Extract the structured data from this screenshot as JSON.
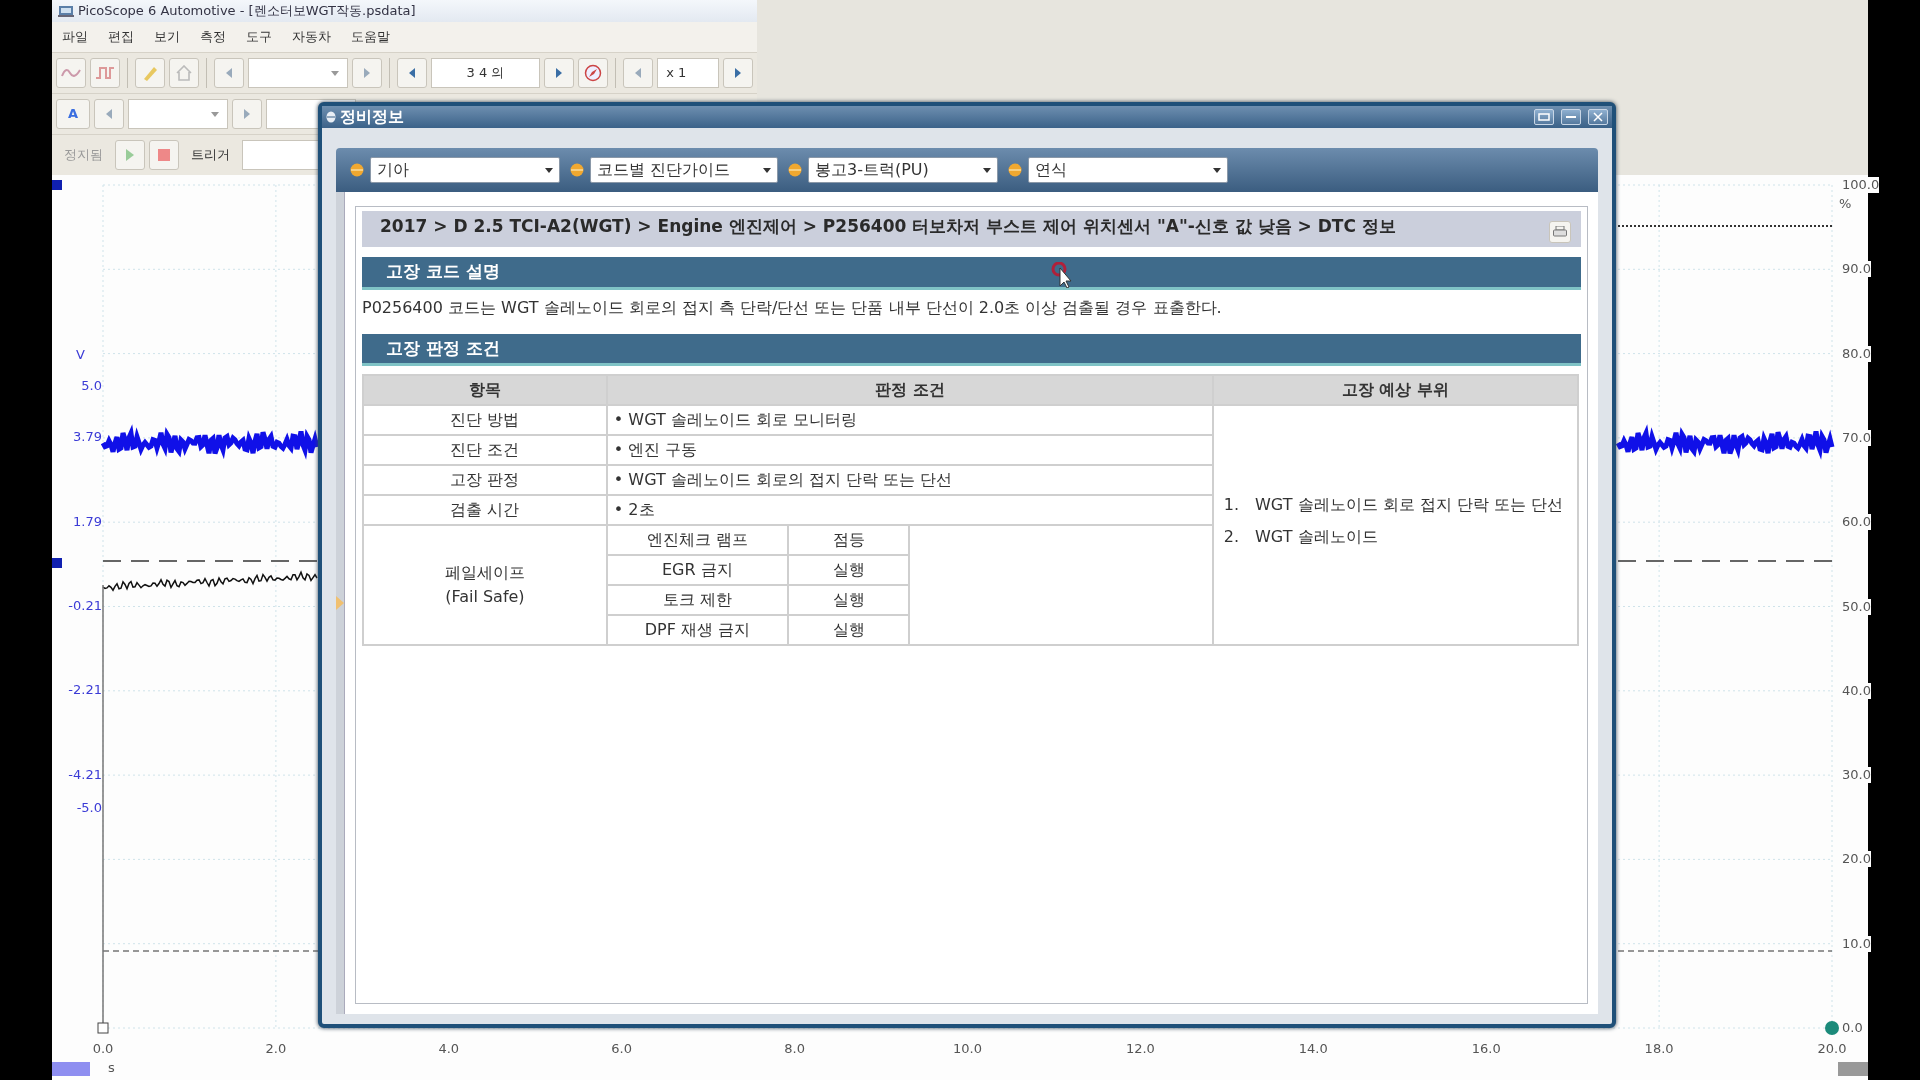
{
  "app": {
    "title": "PicoScope 6 Automotive - [렌소터보WGT작동.psdata]",
    "menu": [
      "파일",
      "편집",
      "보기",
      "측정",
      "도구",
      "자동차",
      "도움말"
    ],
    "toolbar": {
      "capture_count": "3 4 의",
      "zoom": "x 1",
      "channel": "A",
      "run_state": "정지됨",
      "trigger": "트리거"
    }
  },
  "scope": {
    "left_unit": "V",
    "left_labels": [
      "5.0",
      "3.79",
      "1.79",
      "-0.21",
      "-2.21",
      "-4.21",
      "-5.0"
    ],
    "right_unit": "%",
    "right_labels": [
      "100.0",
      "90.0",
      "80.0",
      "70.0",
      "60.0",
      "50.0",
      "40.0",
      "30.0",
      "20.0",
      "10.0",
      "0.0"
    ],
    "x_labels": [
      "0.0",
      "2.0",
      "4.0",
      "6.0",
      "8.0",
      "10.0",
      "12.0",
      "14.0",
      "16.0",
      "18.0",
      "20.0"
    ],
    "x_unit": "s"
  },
  "dialog": {
    "title": "정비정보",
    "filters": [
      {
        "value": "기아"
      },
      {
        "value": "코드별 진단가이드"
      },
      {
        "value": "봉고3-트럭(PU)"
      },
      {
        "value": "연식"
      }
    ],
    "breadcrumb": "2017 > D 2.5 TCI-A2(WGT) > Engine 엔진제어 > P256400 터보차저 부스트 제어 위치센서 \"A\"-신호 값 낮음 > DTC 정보",
    "description": {
      "title": "고장 코드 설명",
      "text": "P0256400 코드는 WGT 솔레노이드 회로의 접지 측 단락/단선 또는 단품 내부 단선이 2.0초 이상 검출될 경우 표출한다."
    },
    "criteria": {
      "title": "고장 판정 조건",
      "columns": [
        "항목",
        "판정 조건",
        "고장 예상 부위"
      ],
      "rows": [
        {
          "item": "진단 방법",
          "condition": "• WGT 솔레노이드 회로 모니터링"
        },
        {
          "item": "진단 조건",
          "condition": "• 엔진 구동"
        },
        {
          "item": "고장 판정",
          "condition": "• WGT 솔레노이드 회로의 접지 단락 또는 단선"
        },
        {
          "item": "검출 시간",
          "condition": "• 2초"
        }
      ],
      "failsafe": {
        "item": "페일세이프\n(Fail Safe)",
        "entries": [
          {
            "name": "엔진체크 램프",
            "value": "점등"
          },
          {
            "name": "EGR 금지",
            "value": "실행"
          },
          {
            "name": "토크 제한",
            "value": "실행"
          },
          {
            "name": "DPF 재생 금지",
            "value": "실행"
          }
        ]
      },
      "suspected_parts": [
        {
          "number": "1.",
          "text": "WGT 솔레노이드 회로 접지 단락 또는 단선"
        },
        {
          "number": "2.",
          "text": "WGT 솔레노이드"
        }
      ]
    }
  }
}
